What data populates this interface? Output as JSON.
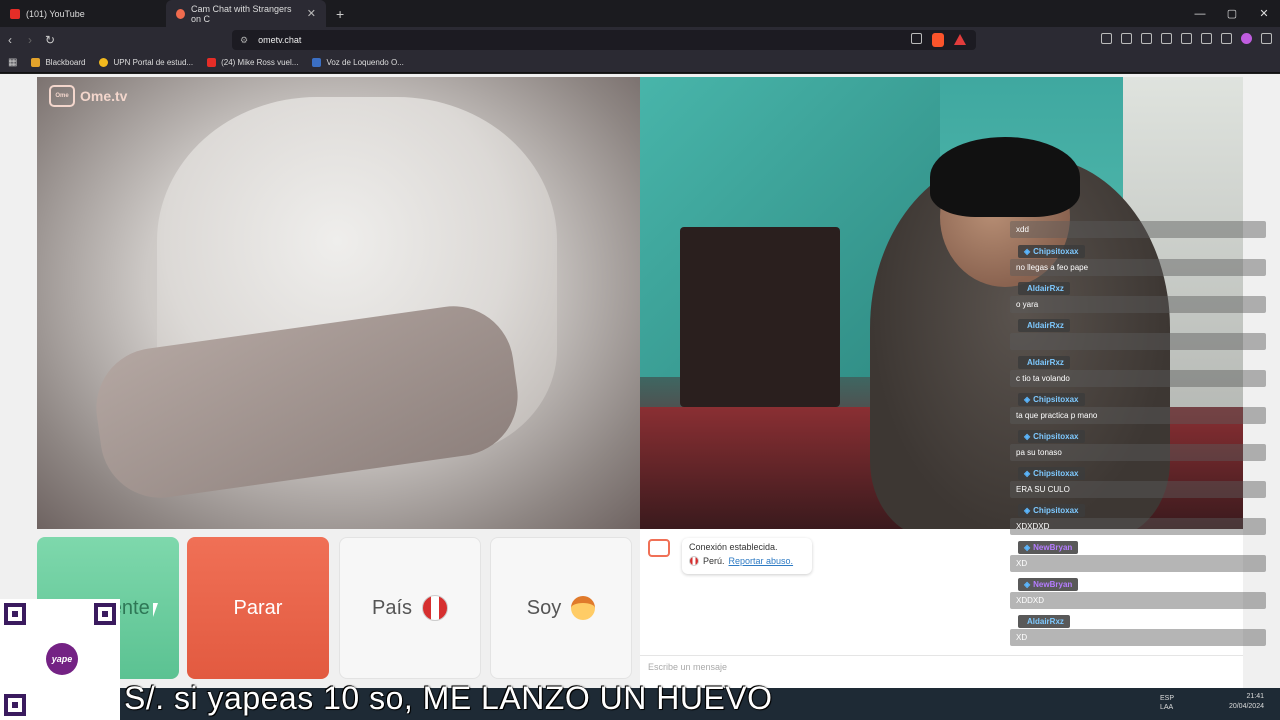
{
  "browser": {
    "tabs": [
      {
        "title": "(101) YouTube",
        "active": false
      },
      {
        "title": "Cam Chat with Strangers on C",
        "active": true
      }
    ],
    "url": "ometv.chat",
    "bookmarks": [
      "Blackboard",
      "UPN Portal de estud...",
      "(24) Mike Ross vuel...",
      "Voz de Loquendo O..."
    ]
  },
  "app": {
    "logo": "Ome.tv",
    "buttons": {
      "next": "Siguiente",
      "stop": "Parar",
      "country": "País",
      "gender": "Soy"
    },
    "system_message": {
      "line1": "Conexión establecida.",
      "country": "Perú.",
      "report": "Reportar abuso."
    },
    "input_placeholder": "Escribe un mensaje"
  },
  "stream_chat": [
    {
      "user": "",
      "text": "xdd"
    },
    {
      "user": "Chipsitoxax",
      "text": "no llegas a feo pape"
    },
    {
      "user": "AldairRxz",
      "text": "o yara"
    },
    {
      "user": "AldairRxz",
      "text": ""
    },
    {
      "user": "AldairRxz",
      "text": "c tio ta volando"
    },
    {
      "user": "Chipsitoxax",
      "text": "ta que practica p mano"
    },
    {
      "user": "Chipsitoxax",
      "text": "pa su tonaso"
    },
    {
      "user": "Chipsitoxax",
      "text": "ERA SU CULO"
    },
    {
      "user": "Chipsitoxax",
      "text": "XDXDXD"
    },
    {
      "user": "NewBryan",
      "text": "XD"
    },
    {
      "user": "NewBryan",
      "text": "XDDXD"
    },
    {
      "user": "AldairRxz",
      "text": "XD"
    }
  ],
  "overlay": {
    "caption": "S/. si yapeas 10 so, ME LANZO UN HUEVO",
    "qr_brand": "yape"
  },
  "taskbar": {
    "lang1": "ESP",
    "lang2": "LAA",
    "time": "21:41",
    "date": "20/04/2024"
  },
  "colors": {
    "next_button": "#5bc292",
    "stop_button": "#e25a40",
    "brand": "#f07056"
  }
}
